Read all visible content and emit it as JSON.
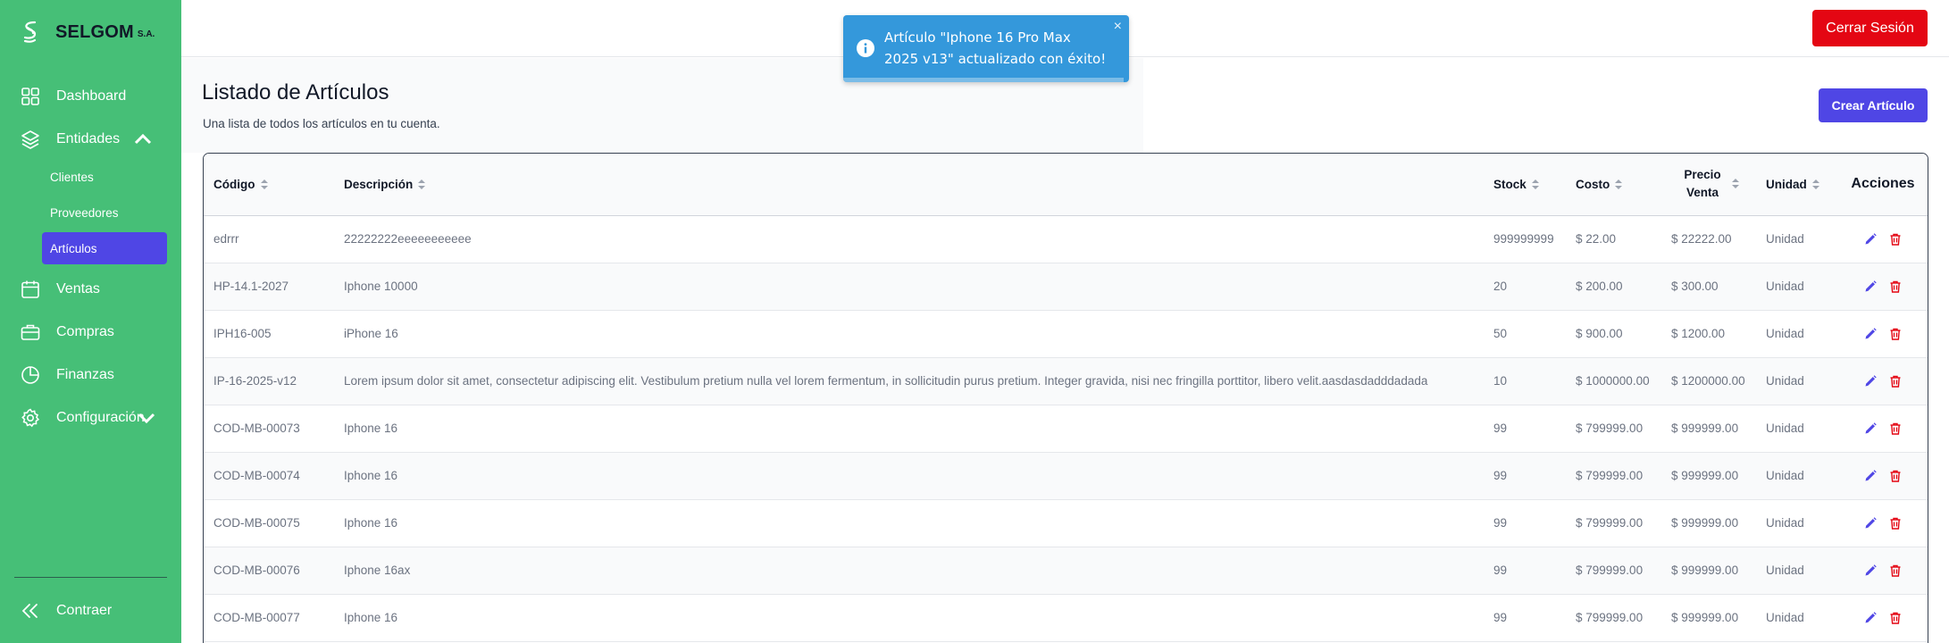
{
  "brand": {
    "name": "SELGOM",
    "suffix": "S.A."
  },
  "sidebar": {
    "items": [
      {
        "label": "Dashboard",
        "icon": "dashboard-icon"
      },
      {
        "label": "Entidades",
        "icon": "layers-icon",
        "expanded": true
      },
      {
        "label": "Ventas",
        "icon": "calendar-icon"
      },
      {
        "label": "Compras",
        "icon": "briefcase-icon"
      },
      {
        "label": "Finanzas",
        "icon": "pie-chart-icon"
      },
      {
        "label": "Configuración",
        "icon": "gear-icon"
      }
    ],
    "sub_items": [
      {
        "label": "Clientes"
      },
      {
        "label": "Proveedores"
      },
      {
        "label": "Artículos",
        "active": true
      }
    ],
    "collapse_label": "Contraer"
  },
  "header": {
    "logout_label": "Cerrar Sesión"
  },
  "toast": {
    "message": "Artículo \"Iphone 16 Pro Max 2025 v13\" actualizado con éxito!",
    "close": "×",
    "progress": 0.98
  },
  "page": {
    "title": "Listado de Artículos",
    "subtitle": "Una lista de todos los artículos en tu cuenta.",
    "create_label": "Crear Artículo"
  },
  "table": {
    "columns": [
      "Código",
      "Descripción",
      "Stock",
      "Costo",
      "Precio Venta",
      "Unidad",
      "Acciones"
    ],
    "rows": [
      [
        "edrrr",
        "22222222eeeeeeeeeee",
        "999999999",
        "$ 22.00",
        "$ 22222.00",
        "Unidad"
      ],
      [
        "HP-14.1-2027",
        "Iphone 10000",
        "20",
        "$ 200.00",
        "$ 300.00",
        "Unidad"
      ],
      [
        "IPH16-005",
        "iPhone 16",
        "50",
        "$ 900.00",
        "$ 1200.00",
        "Unidad"
      ],
      [
        "IP-16-2025-v12",
        "Lorem ipsum dolor sit amet, consectetur adipiscing elit. Vestibulum pretium nulla vel lorem fermentum, in sollicitudin purus pretium. Integer gravida, nisi nec fringilla porttitor, libero velit.aasdasdadddadada",
        "10",
        "$ 1000000.00",
        "$ 1200000.00",
        "Unidad"
      ],
      [
        "COD-MB-00073",
        "Iphone 16",
        "99",
        "$ 799999.00",
        "$ 999999.00",
        "Unidad"
      ],
      [
        "COD-MB-00074",
        "Iphone 16",
        "99",
        "$ 799999.00",
        "$ 999999.00",
        "Unidad"
      ],
      [
        "COD-MB-00075",
        "Iphone 16",
        "99",
        "$ 799999.00",
        "$ 999999.00",
        "Unidad"
      ],
      [
        "COD-MB-00076",
        "Iphone 16ax",
        "99",
        "$ 799999.00",
        "$ 999999.00",
        "Unidad"
      ],
      [
        "COD-MB-00077",
        "Iphone 16",
        "99",
        "$ 799999.00",
        "$ 999999.00",
        "Unidad"
      ]
    ],
    "action_icons": [
      "edit-icon",
      "trash-icon"
    ]
  },
  "colors": {
    "sidebar": "#46bf77",
    "primary": "#4f46e5",
    "danger": "#e40613",
    "toast": "#3498db"
  }
}
